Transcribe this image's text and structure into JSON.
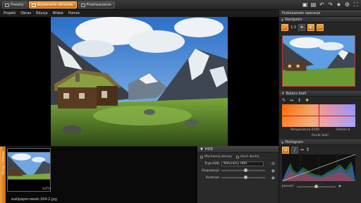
{
  "toolbar": {
    "tabs": [
      {
        "label": "Presety",
        "active": false
      },
      {
        "label": "Wybieranie obrazów",
        "active": true
      },
      {
        "label": "Przetwarzanie",
        "active": false
      }
    ],
    "icons": [
      "frame-icon",
      "film-icon",
      "undo-icon",
      "redo-icon",
      "star-icon",
      "settings-icon",
      "fullscreen-icon"
    ]
  },
  "menu": {
    "items": [
      "Projekt",
      "Obraz",
      "Edycja",
      "Widok",
      "Pomoc"
    ]
  },
  "filmstrip": {
    "side_label": "Obrazy źródłowe",
    "caption": "wallpaper-week-164-2.jpg",
    "badge": "AUTO"
  },
  "hdr": {
    "title": "HDR",
    "opt1": "Wyrównaj obrazy",
    "opt2": "Usuń duchy",
    "mode_label": "Tryb HDR",
    "mode_value": "Naturalny HDR",
    "exposure_label": "Ekspozycja",
    "exposure_level": 0.55,
    "contrast_label": "Kontrast",
    "contrast_level": 0.55
  },
  "rpanel": {
    "header": "Podstawowe operacje",
    "navigator": {
      "title": "Navigator",
      "zoom_label": "1:1"
    },
    "wb": {
      "title": "Balans bieli",
      "temp_label": "Temperatura",
      "temp_value": "6500",
      "tint_label": "Odcień",
      "tint_value": "0",
      "footer": "Punkt bieli"
    },
    "histogram": {
      "title": "Histogram",
      "brightness_label": "Jasność",
      "brightness_level": 0.5
    }
  },
  "colors": {
    "accent": "#e88a20",
    "panel": "#262626",
    "marker": "#cc0000"
  }
}
